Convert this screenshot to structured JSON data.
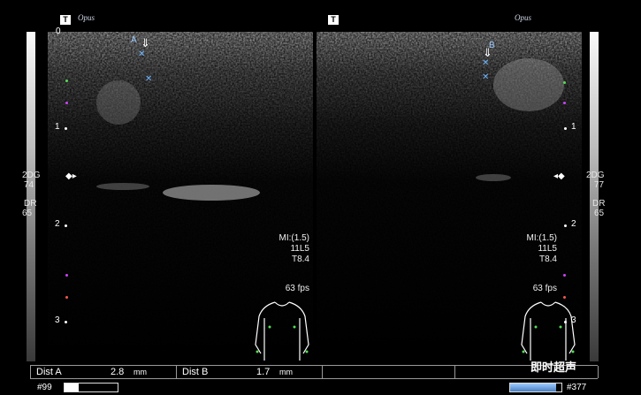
{
  "header": {
    "left_icon": "T",
    "left_brand": "Opus",
    "mid_icon": "T",
    "right_brand": "Opus"
  },
  "left_panel": {
    "depth_top": "0",
    "depth_labels": [
      "1",
      "2",
      "3"
    ],
    "mode": "2DG",
    "gain": "74",
    "dr_label": "DR",
    "dr": "65",
    "marker": "A"
  },
  "right_panel": {
    "depth_labels": [
      "1",
      "2",
      "3"
    ],
    "mode": "2DG",
    "gain": "77",
    "dr_label": "DR",
    "dr": "65",
    "marker": "B"
  },
  "probe_info": {
    "mi": "MI:(1.5)",
    "probe": "11L5",
    "tis": "T8.4",
    "fps": "63 fps"
  },
  "measurements": [
    {
      "label": "Dist  A",
      "value": "2.8",
      "unit": "mm"
    },
    {
      "label": "Dist  B",
      "value": "1.7",
      "unit": "mm"
    }
  ],
  "frames": {
    "left": "#99",
    "right": "#377",
    "left_progress": 0.26,
    "right_progress": 0.9
  },
  "watermark": "即时超声",
  "colors": {
    "background": "#000000",
    "caliper": "#6fb6ff",
    "marker": "#9ecbff"
  }
}
